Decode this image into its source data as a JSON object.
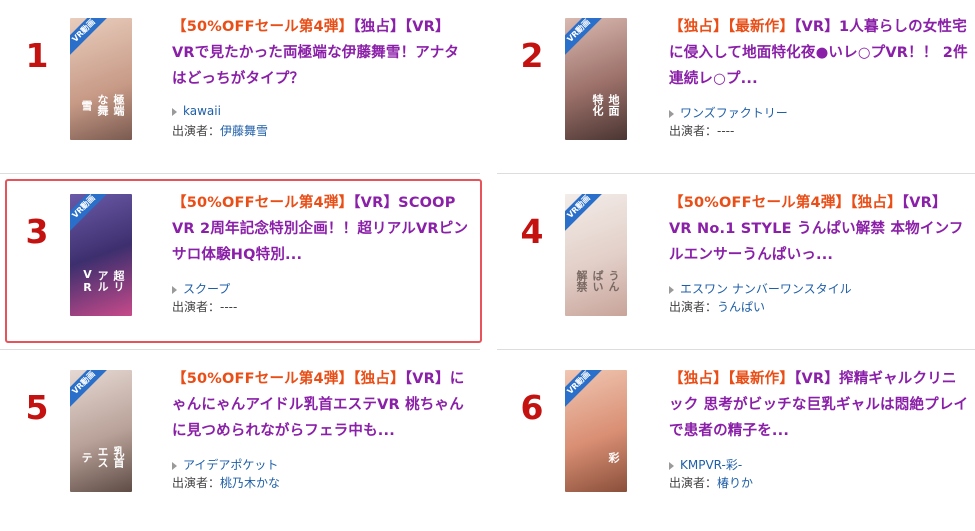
{
  "items": [
    {
      "rank": "1",
      "thumb_text": "極端な舞雪",
      "thumb_bg": "#d9b7a4",
      "title": {
        "tags": [
          "【50%OFFセール第4弾】",
          "【独占】",
          "【VR】"
        ],
        "text": "VRで見たかった両極端な伊藤舞雪！アナタはどっちがタイプ？"
      },
      "maker": "kawaii",
      "cast_label": "出演者：",
      "cast": "伊藤舞雪"
    },
    {
      "rank": "2",
      "thumb_text": "地面特化",
      "thumb_bg": "#a87f78",
      "title": {
        "tags": [
          "【独占】",
          "【最新作】",
          "【VR】"
        ],
        "text": "1人暮らしの女性宅に侵入して地面特化夜●いレ○プVR！！ 2件連続レ○プ..."
      },
      "maker": "ワンズファクトリー",
      "cast_label": "出演者：",
      "cast": "----"
    },
    {
      "rank": "3",
      "thumb_text": "超リアルVR",
      "thumb_bg": "#4a3a7a",
      "title": {
        "tags": [
          "【50%OFFセール第4弾】",
          "【VR】"
        ],
        "text": "SCOOP VR 2周年記念特別企画！！超リアルVRピンサロ体験HQ特別..."
      },
      "maker": "スクープ",
      "cast_label": "出演者：",
      "cast": "----"
    },
    {
      "rank": "4",
      "thumb_text": "うんぱい解禁",
      "thumb_bg": "#e8ddd8",
      "title": {
        "tags": [
          "【50%OFFセール第4弾】",
          "【独占】",
          "【VR】"
        ],
        "text": "VR No.1 STYLE うんぱい解禁 本物インフルエンサーうんぱいっ..."
      },
      "maker": "エスワン ナンバーワンスタイル",
      "cast_label": "出演者：",
      "cast": "うんぱい"
    },
    {
      "rank": "5",
      "thumb_text": "乳首エステ",
      "thumb_bg": "#c9b6ad",
      "title": {
        "tags": [
          "【50%OFFセール第4弾】",
          "【独占】",
          "【VR】"
        ],
        "text": "にゃんにゃんアイドル乳首エステVR 桃ちゃんに見つめられながらフェラ中も..."
      },
      "maker": "アイデアポケット",
      "cast_label": "出演者：",
      "cast": "桃乃木かな"
    },
    {
      "rank": "6",
      "thumb_text": "彩",
      "thumb_bg": "#d69a82",
      "title": {
        "tags": [
          "【独占】",
          "【最新作】",
          "【VR】"
        ],
        "text": "搾精ギャルクリニック 思考がビッチな巨乳ギャルは悶絶プレイで患者の精子を..."
      },
      "maker": "KMPVR-彩-",
      "cast_label": "出演者：",
      "cast": "椿りか"
    }
  ],
  "vr_badge": "VR動画"
}
